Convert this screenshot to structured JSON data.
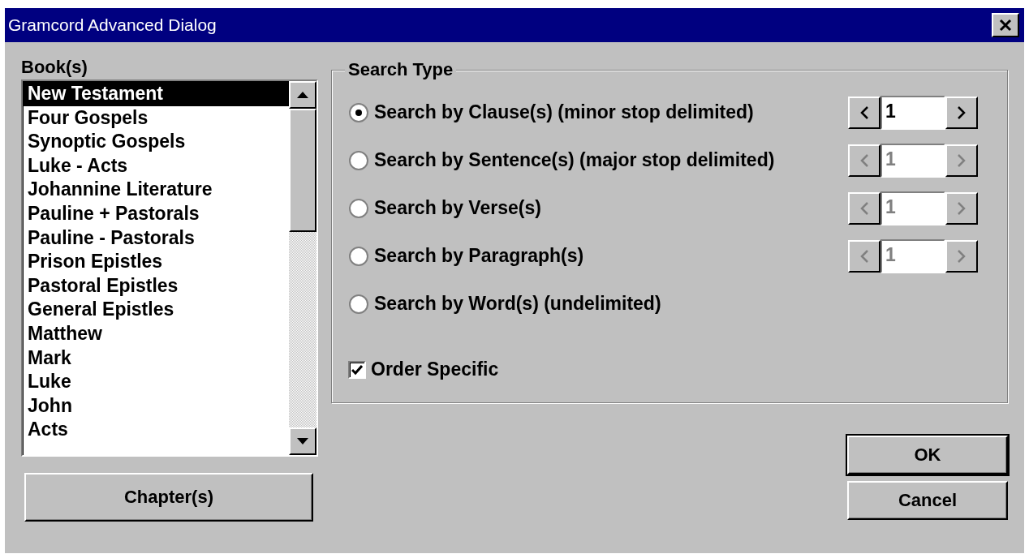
{
  "window": {
    "title": "Gramcord Advanced Dialog"
  },
  "books": {
    "label": "Book(s)",
    "items": [
      {
        "label": "New Testament",
        "selected": true
      },
      {
        "label": "Four Gospels",
        "selected": false
      },
      {
        "label": "Synoptic Gospels",
        "selected": false
      },
      {
        "label": "Luke - Acts",
        "selected": false
      },
      {
        "label": "Johannine Literature",
        "selected": false
      },
      {
        "label": "Pauline + Pastorals",
        "selected": false
      },
      {
        "label": "Pauline - Pastorals",
        "selected": false
      },
      {
        "label": "Prison Epistles",
        "selected": false
      },
      {
        "label": "Pastoral Epistles",
        "selected": false
      },
      {
        "label": "General Epistles",
        "selected": false
      },
      {
        "label": "Matthew",
        "selected": false
      },
      {
        "label": "Mark",
        "selected": false
      },
      {
        "label": "Luke",
        "selected": false
      },
      {
        "label": "John",
        "selected": false
      },
      {
        "label": "Acts",
        "selected": false
      }
    ]
  },
  "chapters_button": "Chapter(s)",
  "search_type": {
    "title": "Search Type",
    "options": [
      {
        "label": "Search by Clause(s) (minor stop delimited)",
        "selected": true,
        "spinner": {
          "value": "1",
          "disabled": false
        }
      },
      {
        "label": "Search by Sentence(s) (major stop delimited)",
        "selected": false,
        "spinner": {
          "value": "1",
          "disabled": true
        }
      },
      {
        "label": "Search by Verse(s)",
        "selected": false,
        "spinner": {
          "value": "1",
          "disabled": true
        }
      },
      {
        "label": "Search by Paragraph(s)",
        "selected": false,
        "spinner": {
          "value": "1",
          "disabled": true
        }
      },
      {
        "label": "Search by Word(s) (undelimited)",
        "selected": false
      }
    ],
    "order_specific": {
      "label": "Order Specific",
      "checked": true
    }
  },
  "buttons": [
    {
      "label": "OK",
      "default": true
    },
    {
      "label": "Cancel",
      "default": false
    }
  ]
}
